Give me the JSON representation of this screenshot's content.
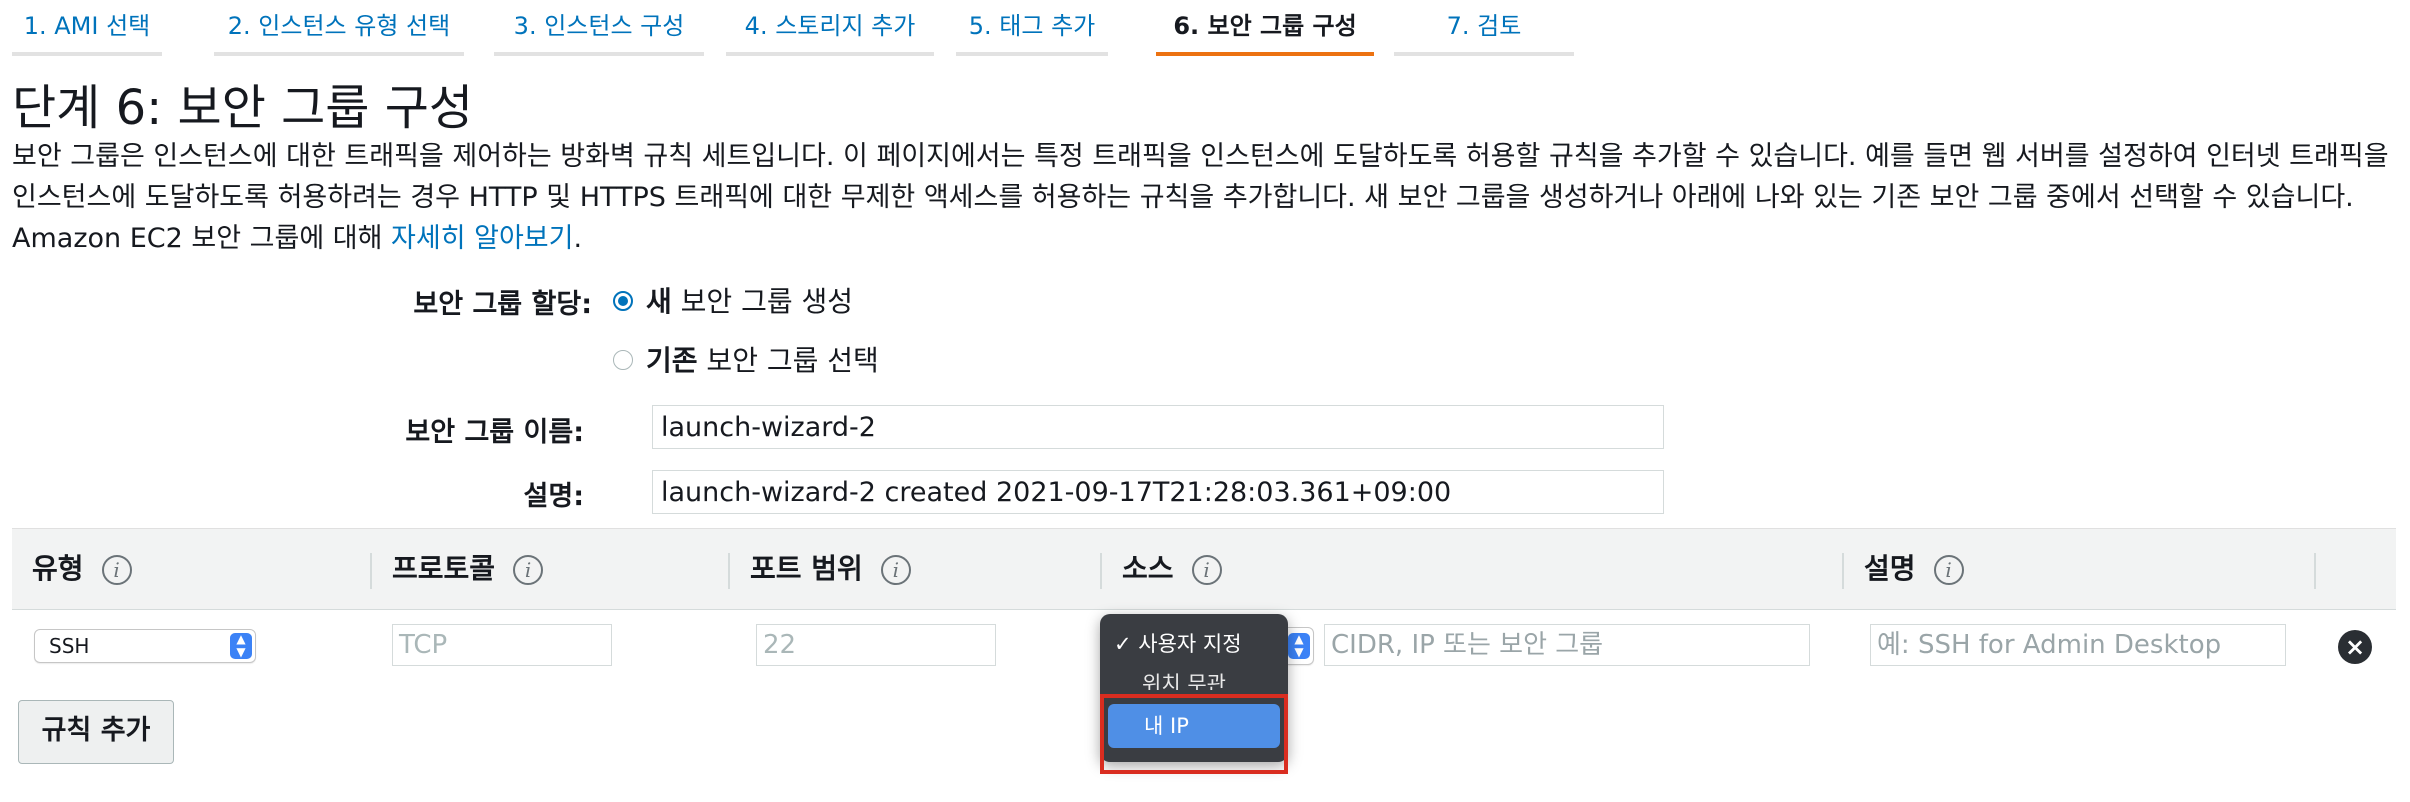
{
  "tabs": [
    {
      "label": "1. AMI 선택",
      "active": false
    },
    {
      "label": "2. 인스턴스 유형 선택",
      "active": false
    },
    {
      "label": "3. 인스턴스 구성",
      "active": false
    },
    {
      "label": "4. 스토리지 추가",
      "active": false
    },
    {
      "label": "5. 태그 추가",
      "active": false
    },
    {
      "label": "6. 보안 그룹 구성",
      "active": true
    },
    {
      "label": "7. 검토",
      "active": false
    }
  ],
  "page": {
    "title": "단계 6: 보안 그룹 구성",
    "intro": "보안 그룹은 인스턴스에 대한 트래픽을 제어하는 방화벽 규칙 세트입니다. 이 페이지에서는 특정 트래픽을 인스턴스에 도달하도록 허용할 규칙을 추가할 수 있습니다. 예를 들면 웹 서버를 설정하여 인터넷 트래픽을 인스턴스에 도달하도록 허용하려는 경우 HTTP 및 HTTPS 트래픽에 대한 무제한 액세스를 허용하는 규칙을 추가합니다. 새 보안 그룹을 생성하거나 아래에 나와 있는 기존 보안 그룹 중에서 선택할 수 있습니다. Amazon EC2 보안 그룹에 대해 ",
    "learn_more": "자세히 알아보기",
    "intro_end": "."
  },
  "form": {
    "assign_label": "보안 그룹 할당:",
    "option_new_bold": "새",
    "option_new_rest": " 보안 그룹 생성",
    "option_existing_bold": "기존",
    "option_existing_rest": " 보안 그룹 선택",
    "selected_option": "new",
    "name_label": "보안 그룹 이름:",
    "name_value": "launch-wizard-2",
    "desc_label": "설명:",
    "desc_value": "launch-wizard-2 created 2021-09-17T21:28:03.361+09:00"
  },
  "table": {
    "headers": [
      "유형",
      "프로토콜",
      "포트 범위",
      "소스",
      "설명"
    ],
    "info_icon": "ⓘ",
    "row": {
      "type": "SSH",
      "protocol": "TCP",
      "port": "22",
      "source_placeholder": "CIDR, IP 또는 보안 그룹",
      "description_placeholder": "예: SSH for Admin Desktop"
    }
  },
  "source_menu": {
    "items": [
      "사용자 지정",
      "위치 무관",
      "내 IP"
    ],
    "checked": "사용자 지정",
    "highlighted": "내 IP"
  },
  "buttons": {
    "add_rule": "규칙 추가"
  },
  "colors": {
    "link": "#0073bb",
    "active_tab_border": "#ec7211",
    "highlight": "#4f8fe6",
    "annotation_red": "#d92d20"
  }
}
